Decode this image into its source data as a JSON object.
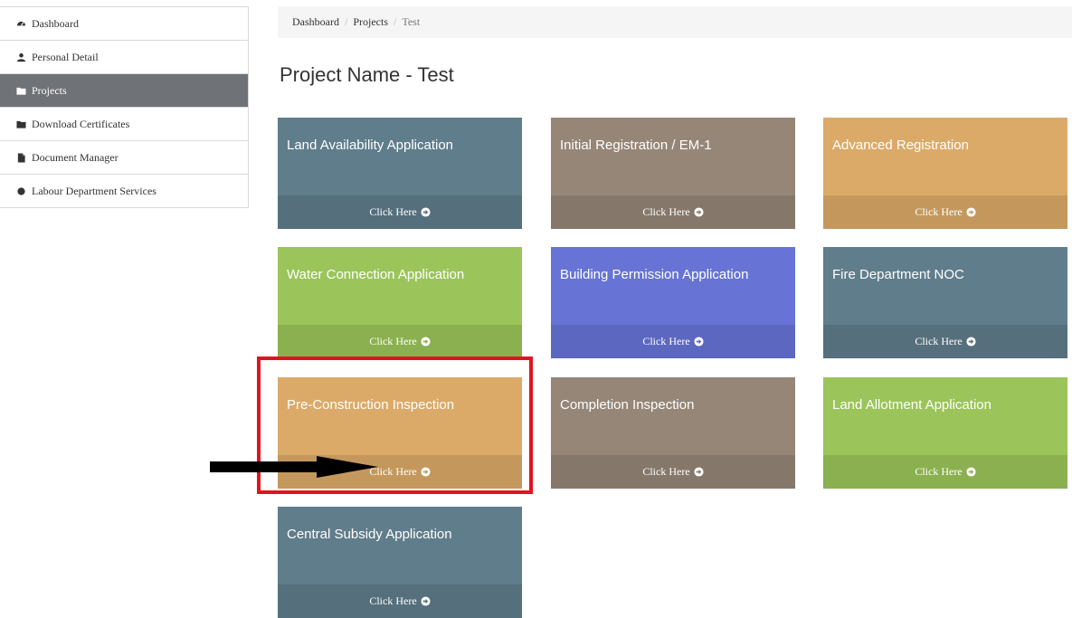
{
  "sidebar": {
    "items": [
      {
        "label": "Dashboard",
        "icon": "dashboard-icon",
        "active": false
      },
      {
        "label": "Personal Detail",
        "icon": "user-icon",
        "active": false
      },
      {
        "label": "Projects",
        "icon": "folder-icon",
        "active": true
      },
      {
        "label": "Download Certificates",
        "icon": "folder-icon",
        "active": false
      },
      {
        "label": "Document Manager",
        "icon": "file-icon",
        "active": false
      },
      {
        "label": "Labour Department Services",
        "icon": "circle-icon",
        "active": false
      }
    ]
  },
  "breadcrumb": {
    "items": [
      "Dashboard",
      "Projects",
      "Test"
    ],
    "separator": "/"
  },
  "page": {
    "title": "Project Name - Test"
  },
  "tiles": [
    {
      "title": "Land Availability Application",
      "button": "Click Here",
      "color": "#607d8b"
    },
    {
      "title": "Initial Registration / EM-1",
      "button": "Click Here",
      "color": "#958677"
    },
    {
      "title": "Advanced Registration",
      "button": "Click Here",
      "color": "#dbaa69"
    },
    {
      "title": "Water Connection Application",
      "button": "Click Here",
      "color": "#9bc45a"
    },
    {
      "title": "Building Permission Application",
      "button": "Click Here",
      "color": "#6774d6"
    },
    {
      "title": "Fire Department NOC",
      "button": "Click Here",
      "color": "#607d8b"
    },
    {
      "title": "Pre-Construction Inspection",
      "button": "Click Here",
      "color": "#dbaa69"
    },
    {
      "title": "Completion Inspection",
      "button": "Click Here",
      "color": "#958677"
    },
    {
      "title": "Land Allotment Application",
      "button": "Click Here",
      "color": "#9bc45a"
    },
    {
      "title": "Central Subsidy Application",
      "button": "Click Here",
      "color": "#607d8b"
    }
  ],
  "annotation": {
    "highlight_color": "#e0141e",
    "arrow_color": "#000000",
    "arrow_icon": "pointer-arrow-icon"
  }
}
